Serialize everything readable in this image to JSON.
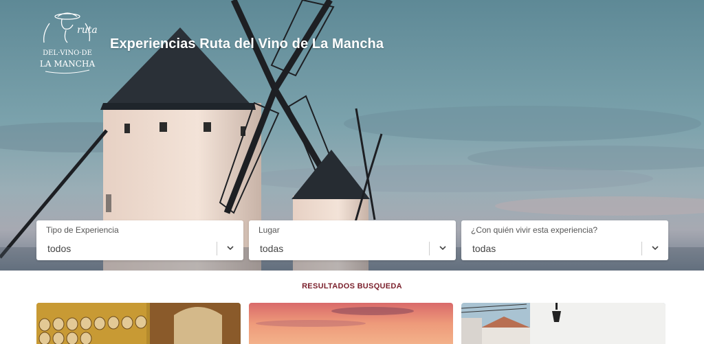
{
  "header": {
    "logo_text": "Ruta DEL·VINO·DE LA MANCHA",
    "site_title": "Experiencias Ruta del Vino de La Mancha"
  },
  "filters": [
    {
      "label": "Tipo de Experiencia",
      "value": "todos"
    },
    {
      "label": "Lugar",
      "value": "todas"
    },
    {
      "label": "¿Con quién vivir esta experiencia?",
      "value": "todas"
    }
  ],
  "results": {
    "title": "RESULTADOS BUSQUEDA"
  },
  "icons": {
    "dropdown": "chevron-down-icon"
  },
  "colors": {
    "results_title": "#7a1f2b",
    "filter_bg": "#ffffff"
  }
}
